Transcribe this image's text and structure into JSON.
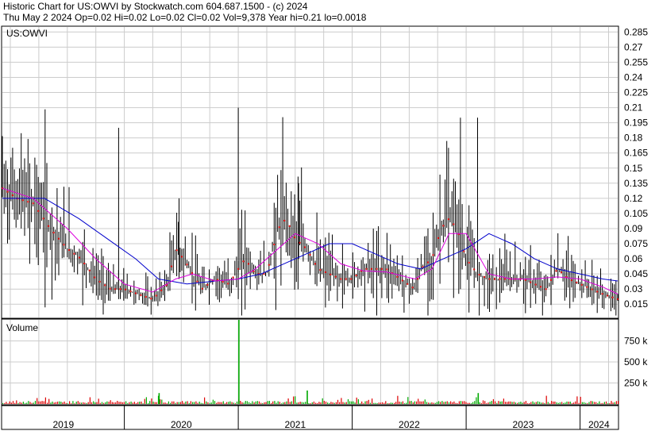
{
  "header": {
    "line1": "Historic Chart for US:OWVI by Stockwatch.com 604.687.1500 - (c) 2024",
    "line2": "Thu May  2 2024  Op=0.02  Hi=0.02  Lo=0.02  Cl=0.02  Vol=9,378  Year hi=0.21  lo=0.0018"
  },
  "colors": {
    "price_bar": "#000000",
    "close_dot": "#dd0000",
    "ma_short": "#dd00dd",
    "ma_long": "#0000cc",
    "volume_up": "#00aa00",
    "volume_down": "#dd0000",
    "grid": "#cccccc"
  },
  "chart_data": [
    {
      "type": "line",
      "title": "US:OWVI",
      "x_axis": "time",
      "x_years": [
        "2019",
        "2020",
        "2021",
        "2022",
        "2023",
        "2024"
      ],
      "ylim": [
        0.0018,
        0.29
      ],
      "y_ticks": [
        "0.285",
        "0.27",
        "0.255",
        "0.24",
        "0.225",
        "0.21",
        "0.195",
        "0.18",
        "0.165",
        "0.15",
        "0.135",
        "0.12",
        "0.105",
        "0.09",
        "0.075",
        "0.06",
        "0.045",
        "0.03",
        "0.015"
      ],
      "grid": true,
      "series": [
        {
          "role": "price",
          "x": [
            2018.93,
            2019.06,
            2019.2,
            2019.35,
            2019.5,
            2019.62,
            2019.75,
            2019.88,
            2020.0,
            2020.12,
            2020.25,
            2020.38,
            2020.45,
            2020.52,
            2020.6,
            2020.68,
            2020.8,
            2020.92,
            2021.0,
            2021.06,
            2021.15,
            2021.25,
            2021.35,
            2021.42,
            2021.5,
            2021.6,
            2021.7,
            2021.8,
            2021.9,
            2022.0,
            2022.1,
            2022.2,
            2022.3,
            2022.42,
            2022.55,
            2022.6,
            2022.7,
            2022.78,
            2022.85,
            2022.92,
            2023.0,
            2023.1,
            2023.2,
            2023.3,
            2023.4,
            2023.5,
            2023.6,
            2023.7,
            2023.8,
            2023.9,
            2024.0,
            2024.1,
            2024.2,
            2024.33
          ],
          "y": [
            0.13,
            0.12,
            0.115,
            0.09,
            0.07,
            0.06,
            0.04,
            0.03,
            0.03,
            0.025,
            0.02,
            0.035,
            0.07,
            0.06,
            0.045,
            0.03,
            0.04,
            0.035,
            0.05,
            0.06,
            0.045,
            0.045,
            0.09,
            0.1,
            0.08,
            0.07,
            0.05,
            0.045,
            0.04,
            0.04,
            0.05,
            0.05,
            0.05,
            0.04,
            0.03,
            0.05,
            0.06,
            0.09,
            0.1,
            0.09,
            0.06,
            0.045,
            0.04,
            0.04,
            0.04,
            0.04,
            0.035,
            0.03,
            0.05,
            0.04,
            0.035,
            0.03,
            0.025,
            0.02
          ]
        },
        {
          "role": "moving-average-short",
          "x": [
            2018.93,
            2019.2,
            2019.5,
            2019.75,
            2020.0,
            2020.25,
            2020.45,
            2020.6,
            2020.8,
            2021.0,
            2021.15,
            2021.35,
            2021.5,
            2021.7,
            2021.9,
            2022.1,
            2022.3,
            2022.55,
            2022.7,
            2022.85,
            2023.0,
            2023.2,
            2023.4,
            2023.6,
            2023.8,
            2024.0,
            2024.2,
            2024.33
          ],
          "y": [
            0.13,
            0.12,
            0.09,
            0.06,
            0.035,
            0.027,
            0.04,
            0.045,
            0.038,
            0.04,
            0.05,
            0.07,
            0.085,
            0.075,
            0.055,
            0.048,
            0.047,
            0.04,
            0.05,
            0.085,
            0.085,
            0.045,
            0.04,
            0.04,
            0.042,
            0.04,
            0.032,
            0.025
          ]
        },
        {
          "role": "moving-average-long",
          "x": [
            2018.93,
            2019.3,
            2019.6,
            2019.85,
            2020.1,
            2020.3,
            2020.55,
            2020.8,
            2021.0,
            2021.2,
            2021.4,
            2021.6,
            2021.8,
            2022.0,
            2022.2,
            2022.4,
            2022.6,
            2022.8,
            2023.0,
            2023.2,
            2023.4,
            2023.6,
            2023.8,
            2024.0,
            2024.2,
            2024.33
          ],
          "y": [
            0.12,
            0.12,
            0.1,
            0.08,
            0.06,
            0.04,
            0.035,
            0.038,
            0.04,
            0.045,
            0.055,
            0.065,
            0.075,
            0.075,
            0.065,
            0.055,
            0.05,
            0.06,
            0.07,
            0.085,
            0.075,
            0.06,
            0.05,
            0.045,
            0.04,
            0.038
          ]
        }
      ]
    },
    {
      "type": "bar",
      "title": "Volume",
      "x_axis": "time",
      "y_ticks": [
        "750 k",
        "500 k",
        "250 k"
      ],
      "ylim": [
        0,
        1000000
      ],
      "peaks": [
        {
          "x": 2021.0,
          "value": 1000000
        },
        {
          "x": 2021.6,
          "value": 160000
        },
        {
          "x": 2020.3,
          "value": 130000
        },
        {
          "x": 2023.1,
          "value": 130000
        }
      ]
    }
  ]
}
